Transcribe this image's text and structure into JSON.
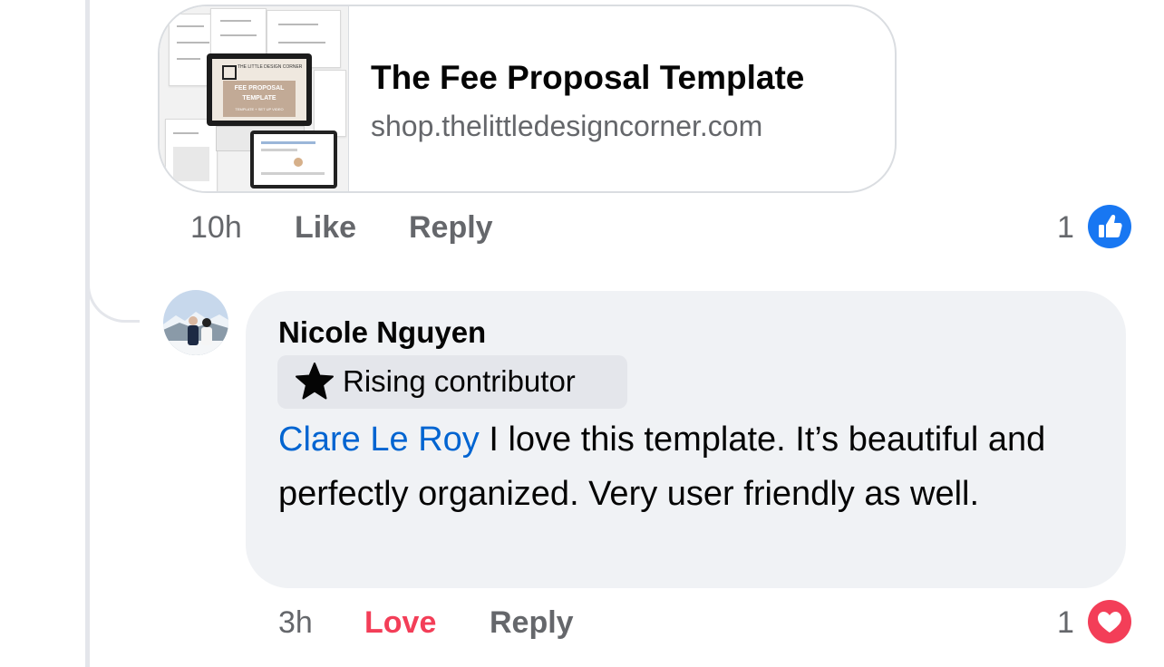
{
  "link_preview": {
    "title": "The Fee Proposal Template",
    "domain": "shop.thelittledesigncorner.com",
    "thumbnail": {
      "brand": "THE LITTLE DESIGN CORNER",
      "heading_line1": "FEE PROPOSAL",
      "heading_line2": "TEMPLATE",
      "subheading": "TEMPLATE + SET UP VIDEO"
    }
  },
  "first_comment_actions": {
    "time": "10h",
    "like_label": "Like",
    "reply_label": "Reply",
    "reaction_count": "1",
    "reaction_icon": "like-icon",
    "reaction_color": "#1877f2"
  },
  "comment": {
    "author": "Nicole Nguyen",
    "badge_icon": "star-icon",
    "badge": "Rising contributor",
    "mention": "Clare Le Roy",
    "text": " I love this template. It’s beautiful and perfectly organized. Very user friendly as well.",
    "mention_color": "#0064d1",
    "bubble_color": "#f0f2f5"
  },
  "second_comment_actions": {
    "time": "3h",
    "love_label": "Love",
    "reply_label": "Reply",
    "reaction_count": "1",
    "reaction_icon": "heart-icon",
    "reaction_color": "#f33e58"
  }
}
